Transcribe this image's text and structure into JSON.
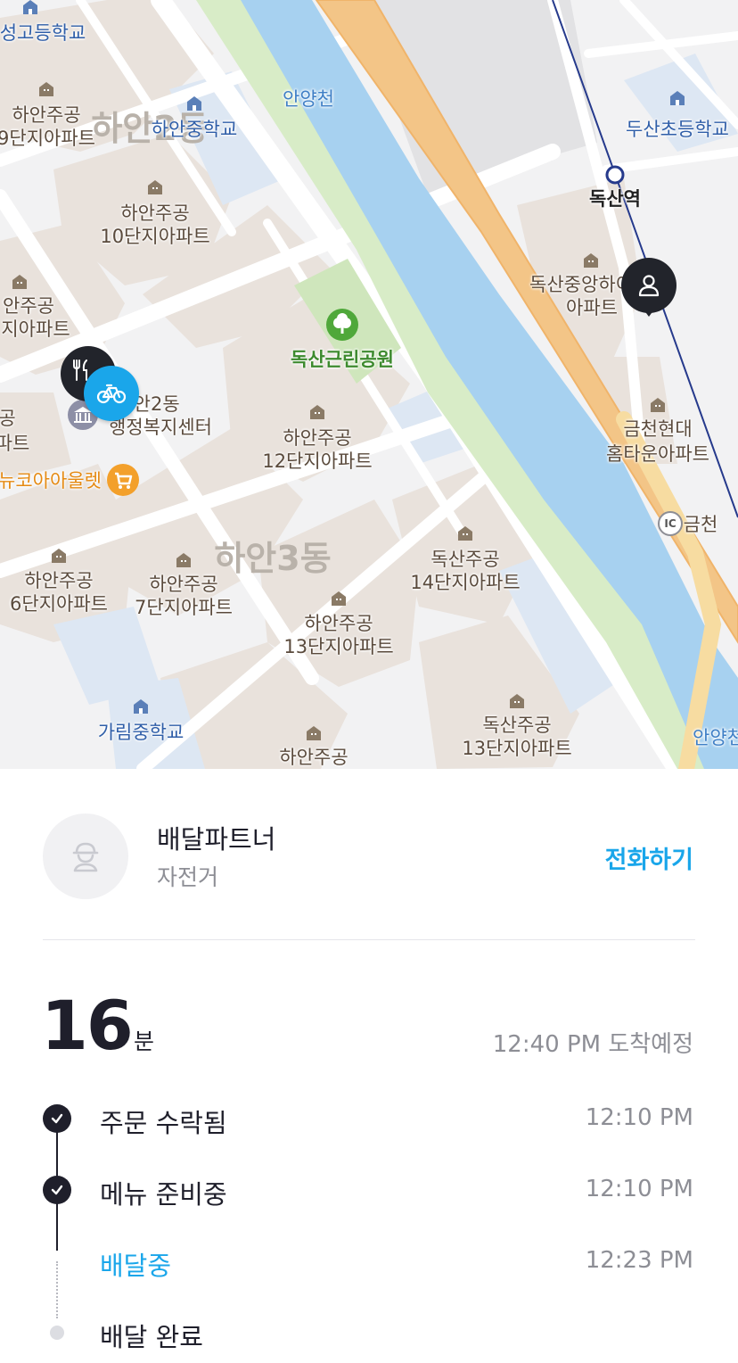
{
  "map": {
    "labels": {
      "school_top_left": "성고등학교",
      "school_hayan_middle": "하안중학교",
      "school_dusan_elem": "두산초등학교",
      "school_garim_middle": "가림중학교",
      "river_top": "안양천",
      "river_bottom": "안양천",
      "station": "독산역",
      "park": "독산근린공원",
      "apt_hayan_9_line1": "하안주공",
      "apt_hayan_9_line2": "9단지아파트",
      "apt_hayan_10_line1": "하안주공",
      "apt_hayan_10_line2": "10단지아파트",
      "apt_hayan_left_line1": "안주공",
      "apt_hayan_left_line2": "지아파트",
      "apt_hayan_12_line1": "하안주공",
      "apt_hayan_12_line2": "12단지아파트",
      "apt_hayan_6_line1": "하안주공",
      "apt_hayan_6_line2": "6단지아파트",
      "apt_hayan_7_line1": "하안주공",
      "apt_hayan_7_line2": "7단지아파트",
      "apt_hayan_13_line1": "하안주공",
      "apt_hayan_13_line2": "13단지아파트",
      "apt_hayan_bottom": "하안주공",
      "apt_dongsan_14_line1": "독산주공",
      "apt_dongsan_14_line2": "14단지아파트",
      "apt_dongsan_13_line1": "독산주공",
      "apt_dongsan_13_line2": "13단지아파트",
      "apt_dongsan_jungang_line1": "독산중앙하이",
      "apt_dongsan_jungang_line2": "아파트",
      "apt_geumcheon_line1": "금천현대",
      "apt_geumcheon_line2": "홈타운아파트",
      "admin_center_line1": "하안2동",
      "admin_center_line2": "행정복지센터",
      "outlet": "뉴코아아울렛",
      "ic": "금천",
      "ic_badge": "IC",
      "district_hayan3": "하안3동",
      "district_hayan_top": "하안2동",
      "edge_left_1": "공",
      "edge_left_2": "파트"
    }
  },
  "partner": {
    "name": "배달파트너",
    "vehicle": "자전거",
    "call_label": "전화하기"
  },
  "eta": {
    "minutes": "16",
    "unit": "분",
    "arrival": "12:40 PM 도착예정"
  },
  "steps": [
    {
      "label": "주문 수락됨",
      "time": "12:10 PM",
      "state": "done"
    },
    {
      "label": "메뉴 준비중",
      "time": "12:10 PM",
      "state": "done"
    },
    {
      "label": "배달중",
      "time": "12:23 PM",
      "state": "active"
    },
    {
      "label": "배달 완료",
      "time": "",
      "state": "pending"
    }
  ],
  "colors": {
    "accent": "#1aa6ea",
    "dark": "#1f1f2b",
    "muted": "#8d8e95"
  }
}
